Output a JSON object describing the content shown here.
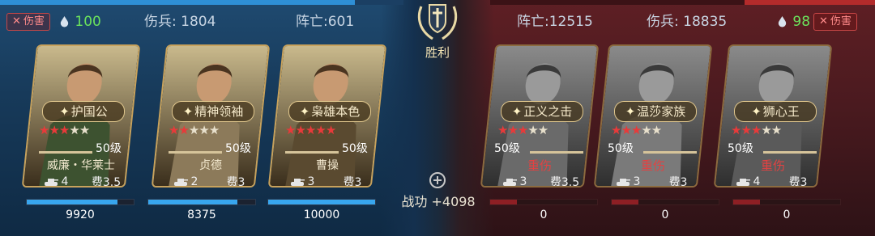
{
  "left_team": {
    "damage_label": "伤害",
    "power": "100",
    "wounded": "伤兵: 1804",
    "dead": "阵亡:601",
    "bar_fill": 0.88
  },
  "right_team": {
    "damage_label": "伤害",
    "power": "98",
    "dead": "阵亡:12515",
    "wounded": "伤兵: 18835",
    "bar_fill": 0.34
  },
  "center": {
    "result": "胜利",
    "merit": "战功 +4098"
  },
  "left_heroes": [
    {
      "name": "威廉・华莱士",
      "title": "护国公",
      "stars": 3,
      "max_stars": 5,
      "level": "50级",
      "troops": "4",
      "cost": "费3.5",
      "hp_text": "9920",
      "hp_fill": 0.85,
      "state": "active",
      "theme": "#3d5230"
    },
    {
      "name": "贞德",
      "title": "精神领袖",
      "stars": 2,
      "max_stars": 5,
      "level": "50级",
      "troops": "2",
      "cost": "费3",
      "hp_text": "8375",
      "hp_fill": 0.83,
      "state": "active",
      "theme": "#8c7a5a"
    },
    {
      "name": "曹操",
      "title": "枭雄本色",
      "stars": 5,
      "max_stars": 5,
      "level": "50级",
      "troops": "3",
      "cost": "费3",
      "hp_text": "10000",
      "hp_fill": 1.0,
      "state": "active",
      "theme": "#5a4a30"
    }
  ],
  "right_heroes": [
    {
      "name": "重伤",
      "title": "正义之击",
      "stars": 3,
      "max_stars": 5,
      "level": "50级",
      "troops": "3",
      "cost": "费3.5",
      "hp_text": "0",
      "hp_fill": 0,
      "state": "wounded",
      "theme": "#6a6a6a"
    },
    {
      "name": "重伤",
      "title": "温莎家族",
      "stars": 3,
      "max_stars": 5,
      "level": "50级",
      "troops": "3",
      "cost": "费3",
      "hp_text": "0",
      "hp_fill": 0,
      "state": "wounded",
      "theme": "#7a7a7a"
    },
    {
      "name": "重伤",
      "title": "狮心王",
      "stars": 3,
      "max_stars": 5,
      "level": "50级",
      "troops": "4",
      "cost": "费3",
      "hp_text": "0",
      "hp_fill": 0,
      "state": "wounded",
      "theme": "#5a5a5a"
    }
  ],
  "colors": {
    "ally": "#2e8fd6",
    "enemy": "#b32b2b",
    "gold": "#c8a25c",
    "green": "#6be35c"
  },
  "icons": {
    "damage": "x-icon",
    "power": "water-drop-icon",
    "troops": "tank-icon",
    "emblem": "sword-laurel-icon",
    "merit": "merit-wreath-icon"
  }
}
